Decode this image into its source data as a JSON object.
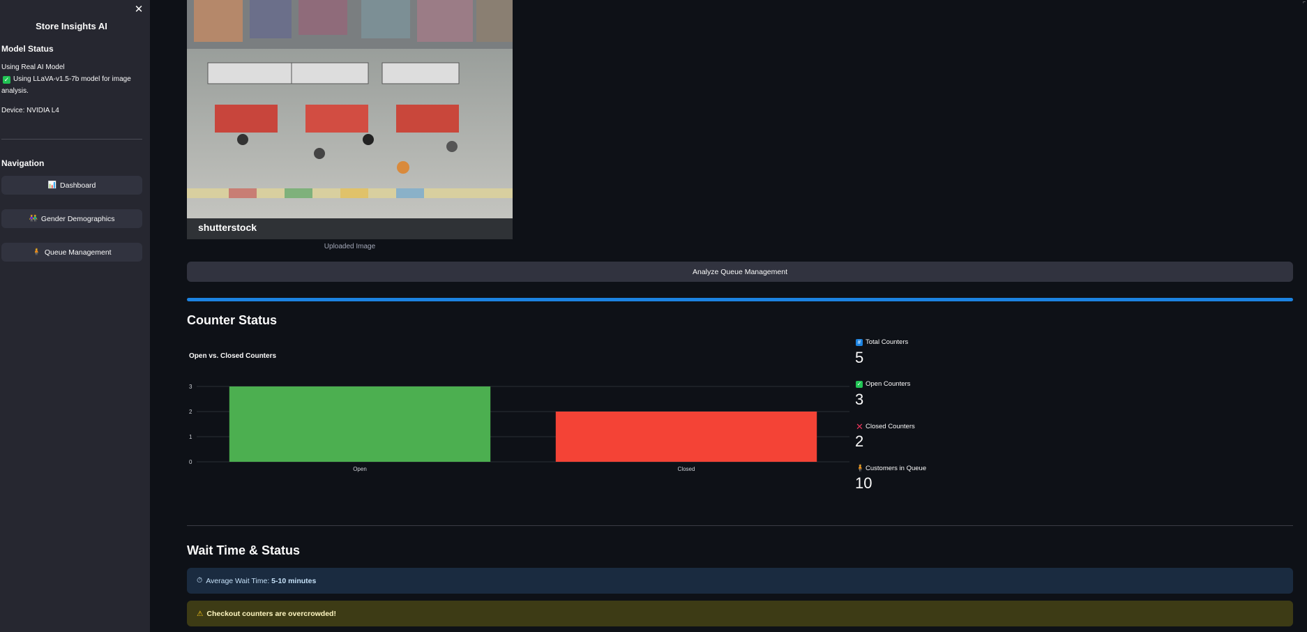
{
  "sidebar": {
    "title": "Store Insights AI",
    "model_status_heading": "Model Status",
    "model_line": "Using Real AI Model",
    "model_detail": "Using LLaVA-v1.5-7b model for image analysis.",
    "device": "Device: NVIDIA L4",
    "navigation_heading": "Navigation",
    "nav": [
      {
        "icon": "📊",
        "label": "Dashboard"
      },
      {
        "icon": "👫",
        "label": "Gender Demographics"
      },
      {
        "icon": "🧍",
        "label": "Queue Management"
      }
    ]
  },
  "image": {
    "watermark": "shutterstock",
    "caption": "Uploaded Image"
  },
  "analyze_button": "Analyze Queue Management",
  "progress": 1.0,
  "counter_status": {
    "heading": "Counter Status",
    "metrics": [
      {
        "icon": "123-icon",
        "label": "Total Counters",
        "value": "5"
      },
      {
        "icon": "check-icon",
        "label": "Open Counters",
        "value": "3"
      },
      {
        "icon": "cross-icon",
        "label": "Closed Counters",
        "value": "2"
      },
      {
        "icon": "person-icon",
        "label": "Customers in Queue",
        "value": "10"
      }
    ]
  },
  "chart_data": {
    "type": "bar",
    "title": "Open vs. Closed Counters",
    "categories": [
      "Open",
      "Closed"
    ],
    "values": [
      3,
      2
    ],
    "colors": [
      "#4caf50",
      "#f44336"
    ],
    "ylim": [
      0,
      3
    ],
    "yticks": [
      0,
      1,
      2,
      3
    ],
    "grid": true
  },
  "wait": {
    "heading": "Wait Time & Status",
    "info_prefix": "Average Wait Time: ",
    "info_value": "5-10 minutes",
    "warning": "Checkout counters are overcrowded!"
  },
  "colors": {
    "accent": "#1c83e1",
    "background": "#0e1117",
    "sidebar": "#262730"
  }
}
